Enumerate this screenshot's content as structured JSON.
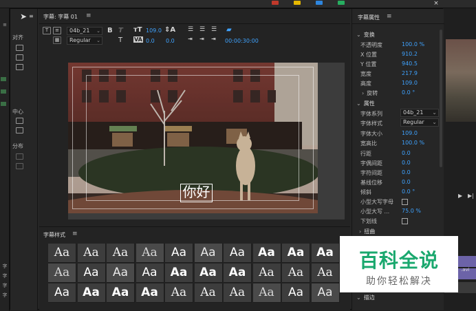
{
  "title_panel": {
    "tab_label": "字幕: 字幕 01",
    "menu_icon": "hamburger-icon",
    "font_family_value": "04b_21",
    "font_style_value": "Regular",
    "font_size_value": "109.0",
    "kerning_value": "0.0",
    "leading_value": "0.0",
    "timecode": "00:00:30:00",
    "caption_text": "你好"
  },
  "tools": {
    "align_label": "对齐",
    "center_label": "中心",
    "distribute_label": "分布"
  },
  "style_panel": {
    "tab_label": "字幕样式",
    "swatch_text": "Aa"
  },
  "properties": {
    "header": "字幕属性",
    "transform_group": "变换",
    "opacity_label": "不透明度",
    "opacity_value": "100.0 %",
    "x_label": "X 位置",
    "x_value": "910.2",
    "y_label": "Y 位置",
    "y_value": "940.5",
    "width_label": "宽度",
    "width_value": "217.9",
    "height_label": "高度",
    "height_value": "109.0",
    "rotation_label": "旋转",
    "rotation_value": "0.0 °",
    "attributes_group": "属性",
    "font_family_label": "字体系列",
    "font_family_value": "04b_21",
    "font_style_label": "字体样式",
    "font_style_value": "Regular",
    "font_size_label": "字体大小",
    "font_size_value": "109.0",
    "aspect_label": "宽高比",
    "aspect_value": "100.0 %",
    "leading_label": "行距",
    "leading_value": "0.0",
    "kerning_label": "字偶间距",
    "kerning_value": "0.0",
    "tracking_label": "字符间距",
    "tracking_value": "0.0",
    "baseline_label": "基线位移",
    "baseline_value": "0.0",
    "slant_label": "倾斜",
    "slant_value": "0.0 °",
    "smallcaps_label": "小型大写字母",
    "smallcaps_size_label": "小型大写 ...",
    "smallcaps_size_value": "75.0 %",
    "underline_label": "下划线",
    "distort_group": "扭曲",
    "stroke_group": "描边"
  },
  "outer": {
    "close": "×",
    "right_clip_name": ".avi"
  },
  "watermark": {
    "main": "百科全说",
    "sub": "助你轻松解决"
  },
  "colors": {
    "accent_blue": "#3fa3ff",
    "watermark_green": "#1aa86e",
    "panel_bg": "#262626"
  }
}
